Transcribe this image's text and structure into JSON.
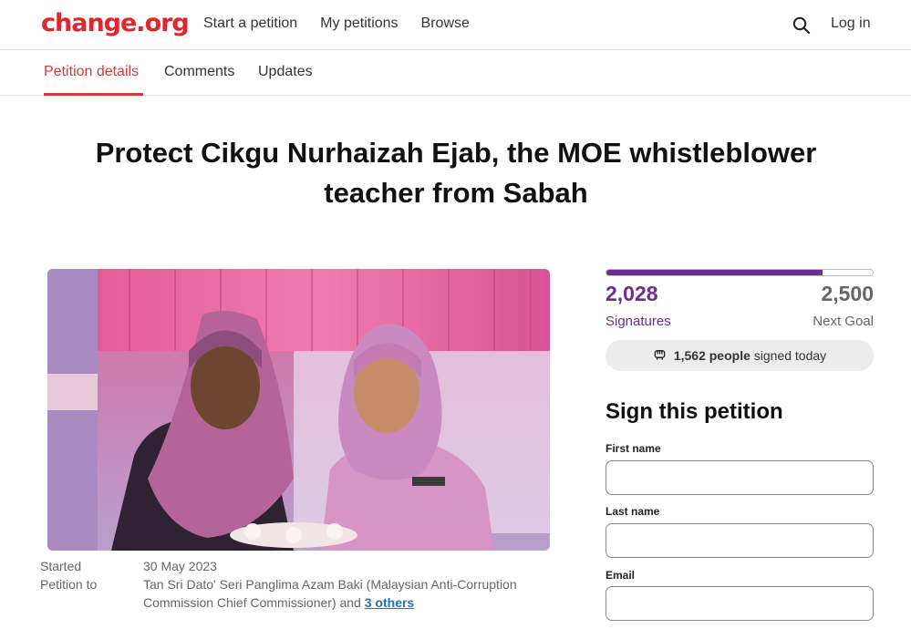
{
  "nav": {
    "logo": "change.org",
    "links": [
      "Start a petition",
      "My petitions",
      "Browse"
    ],
    "login": "Log in"
  },
  "tabs": [
    "Petition details",
    "Comments",
    "Updates"
  ],
  "active_tab": "Petition details",
  "petition": {
    "title": "Protect Cikgu Nurhaizah Ejab, the MOE whistleblower teacher from Sabah",
    "started_label": "Started",
    "started_date": "30 May 2023",
    "petition_to_label": "Petition to",
    "petition_to_value": "Tan Sri Dato' Seri Panglima Azam Baki (Malaysian Anti-Corruption Commission Chief Commissioner) and",
    "others_link": "3 others"
  },
  "progress": {
    "signatures": "2,028",
    "signatures_label": "Signatures",
    "goal": "2,500",
    "goal_label": "Next Goal",
    "fraction": 0.811,
    "today_count": "1,562 people",
    "today_text": "signed today"
  },
  "form": {
    "title": "Sign this petition",
    "first_name_label": "First name",
    "last_name_label": "Last name",
    "email_label": "Email"
  },
  "colors": {
    "brand": "#e0262d",
    "accent_tab": "#d23a3e",
    "progress": "#6b2d8f",
    "link": "#1f73b7"
  }
}
